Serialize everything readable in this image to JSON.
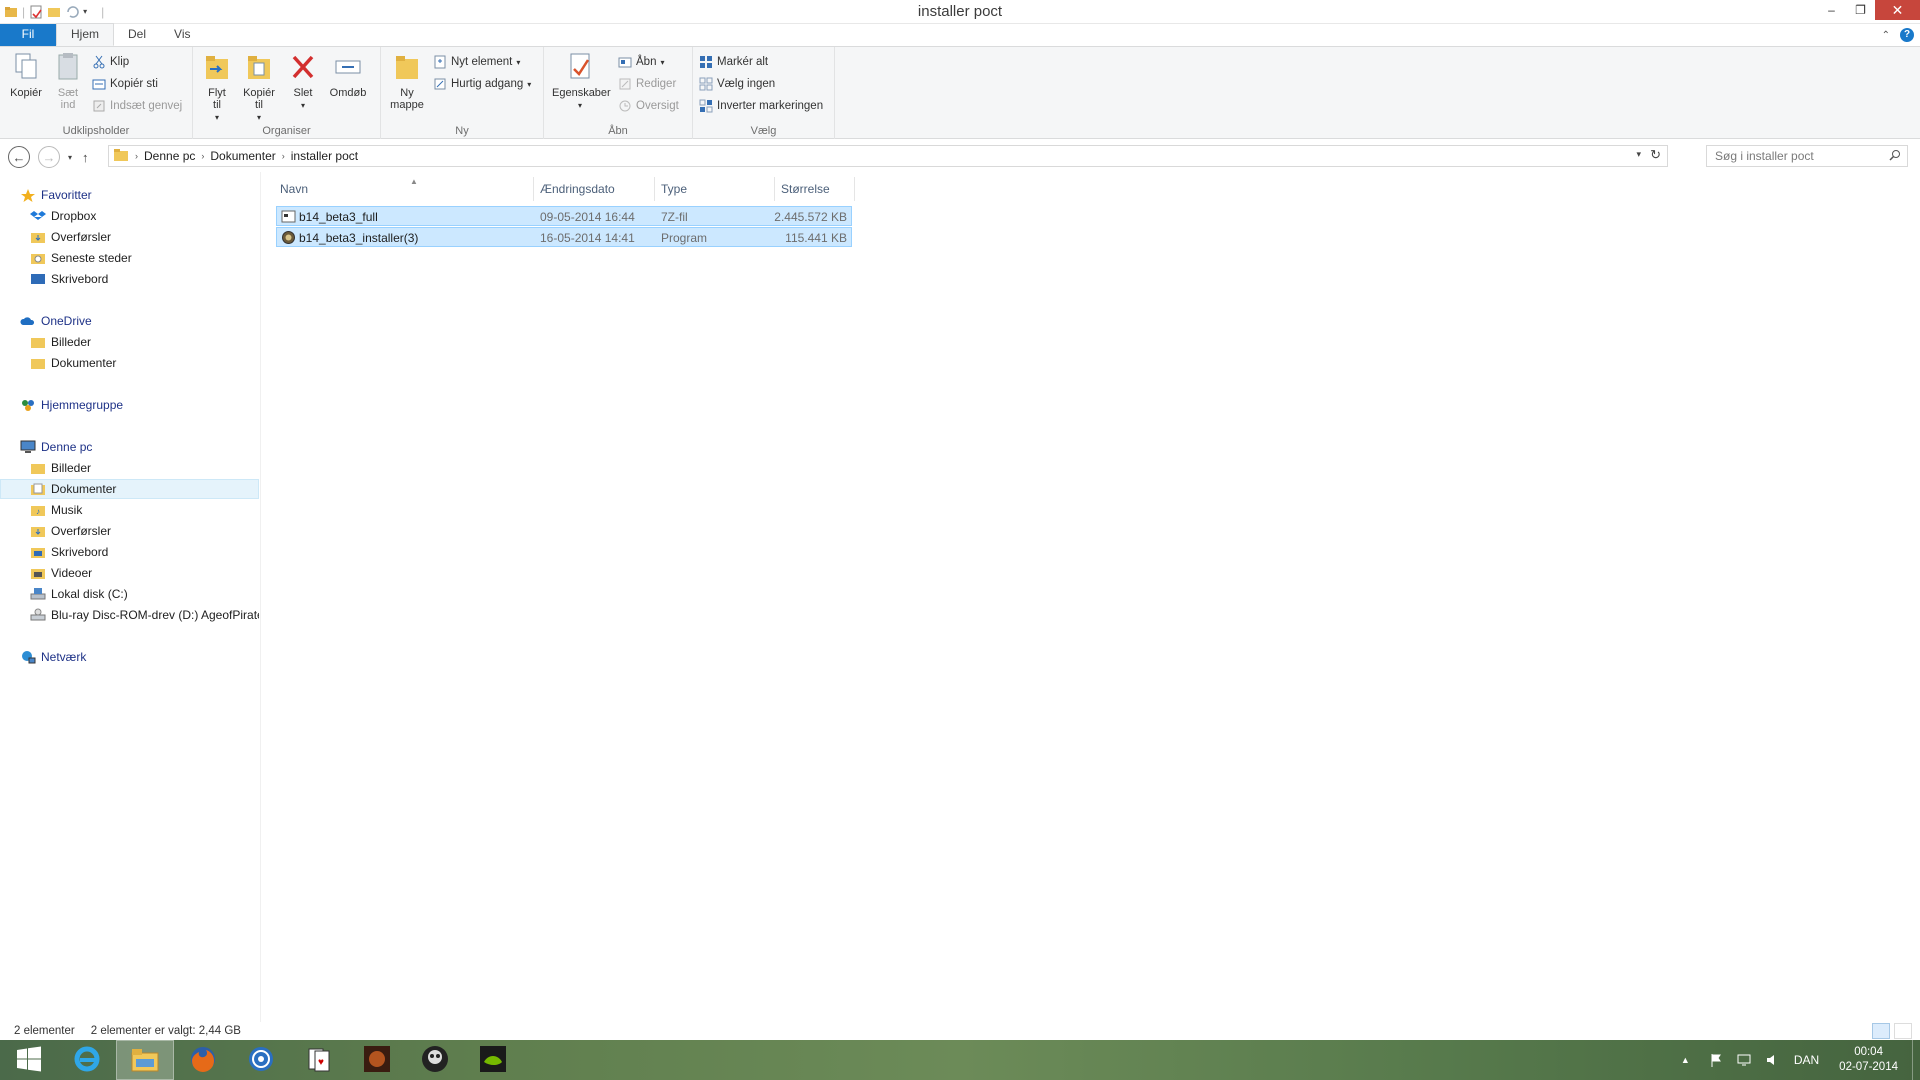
{
  "window": {
    "title": "installer poct",
    "controls": {
      "minimize": "–",
      "maximize": "❐",
      "close": "✕"
    }
  },
  "ribbon_tabs": {
    "file": "Fil",
    "home": "Hjem",
    "share": "Del",
    "view": "Vis"
  },
  "ribbon": {
    "clipboard": {
      "copy": "Kopiér",
      "paste": "Sæt ind",
      "cut": "Klip",
      "copy_path": "Kopiér sti",
      "paste_shortcut": "Indsæt genvej",
      "label": "Udklipsholder"
    },
    "organize": {
      "move_to": "Flyt til",
      "copy_to": "Kopiér til",
      "delete": "Slet",
      "rename": "Omdøb",
      "label": "Organiser"
    },
    "new": {
      "new_folder": "Ny mappe",
      "new_item": "Nyt element",
      "easy_access": "Hurtig adgang",
      "label": "Ny"
    },
    "open": {
      "properties": "Egenskaber",
      "open": "Åbn",
      "edit": "Rediger",
      "history": "Oversigt",
      "label": "Åbn"
    },
    "select": {
      "select_all": "Markér alt",
      "select_none": "Vælg ingen",
      "invert": "Inverter markeringen",
      "label": "Vælg"
    }
  },
  "address": {
    "crumbs": [
      "Denne pc",
      "Dokumenter",
      "installer poct"
    ],
    "search_placeholder": "Søg i installer poct"
  },
  "nav_pane": {
    "favorites": "Favoritter",
    "fav_items": [
      "Dropbox",
      "Overførsler",
      "Seneste steder",
      "Skrivebord"
    ],
    "onedrive": "OneDrive",
    "onedrive_items": [
      "Billeder",
      "Dokumenter"
    ],
    "homegroup": "Hjemmegruppe",
    "this_pc": "Denne pc",
    "pc_items": [
      "Billeder",
      "Dokumenter",
      "Musik",
      "Overførsler",
      "Skrivebord",
      "Videoer",
      "Lokal disk (C:)",
      "Blu-ray Disc-ROM-drev (D:) AgeofPirate"
    ],
    "network": "Netværk"
  },
  "columns": {
    "name": "Navn",
    "date": "Ændringsdato",
    "type": "Type",
    "size": "Størrelse"
  },
  "files": [
    {
      "name": "b14_beta3_full",
      "date": "09-05-2014 16:44",
      "type": "7Z-fil",
      "size": "2.445.572 KB"
    },
    {
      "name": "b14_beta3_installer(3)",
      "date": "16-05-2014 14:41",
      "type": "Program",
      "size": "115.441 KB"
    }
  ],
  "status": {
    "count": "2 elementer",
    "selection": "2 elementer er valgt: 2,44 GB"
  },
  "tray": {
    "lang": "DAN",
    "time": "00:04",
    "date": "02-07-2014"
  },
  "colors": {
    "accent": "#1979ca",
    "selection": "#cce8ff",
    "selection_border": "#99d1ff",
    "close": "#c7463c"
  }
}
